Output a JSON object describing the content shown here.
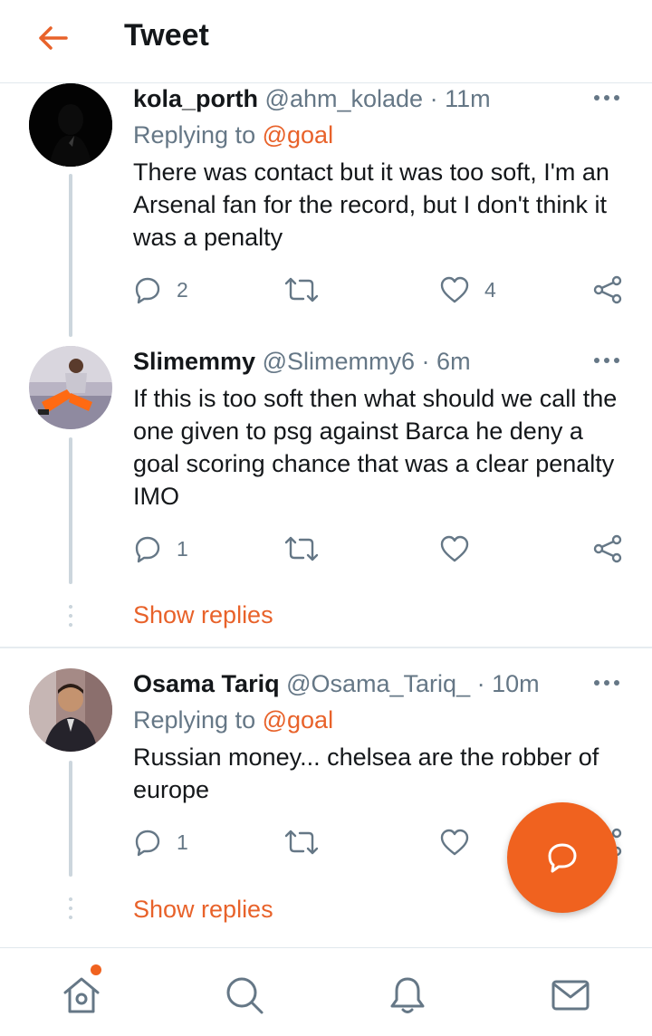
{
  "header": {
    "title": "Tweet"
  },
  "tweets": [
    {
      "name": "kola_porth",
      "handle": "@ahm_kolade",
      "sep": "·",
      "time": "11m",
      "replying_prefix": "Replying to",
      "replying_mention": "@goal",
      "text": "There was contact but it was too soft, I'm an Arsenal fan for the record, but I don't think it was a penalty",
      "reply_count": "2",
      "retweet_count": "",
      "like_count": "4"
    },
    {
      "name": "Slimemmy",
      "handle": "@Slimemmy6",
      "sep": "·",
      "time": "6m",
      "text": "If this is too soft then what should we call the one given to psg against Barca  he deny a goal scoring chance that was a clear penalty IMO",
      "reply_count": "1",
      "retweet_count": "",
      "like_count": "",
      "show_replies": "Show replies"
    },
    {
      "name": "Osama Tariq",
      "handle": "@Osama_Tariq_",
      "sep": "·",
      "time": "10m",
      "replying_prefix": "Replying to",
      "replying_mention": "@goal",
      "text": "Russian money... chelsea are the robber of europe",
      "reply_count": "1",
      "retweet_count": "",
      "like_count": "",
      "show_replies": "Show replies"
    }
  ],
  "colors": {
    "accent": "#f0621f",
    "text": "#14171a",
    "secondary": "#657786",
    "line": "#ccd6dd"
  },
  "icons": [
    "back-arrow-icon",
    "more-icon",
    "reply-icon",
    "retweet-icon",
    "like-icon",
    "share-icon",
    "compose-reply-icon",
    "home-icon",
    "search-icon",
    "bell-icon",
    "mail-icon"
  ]
}
